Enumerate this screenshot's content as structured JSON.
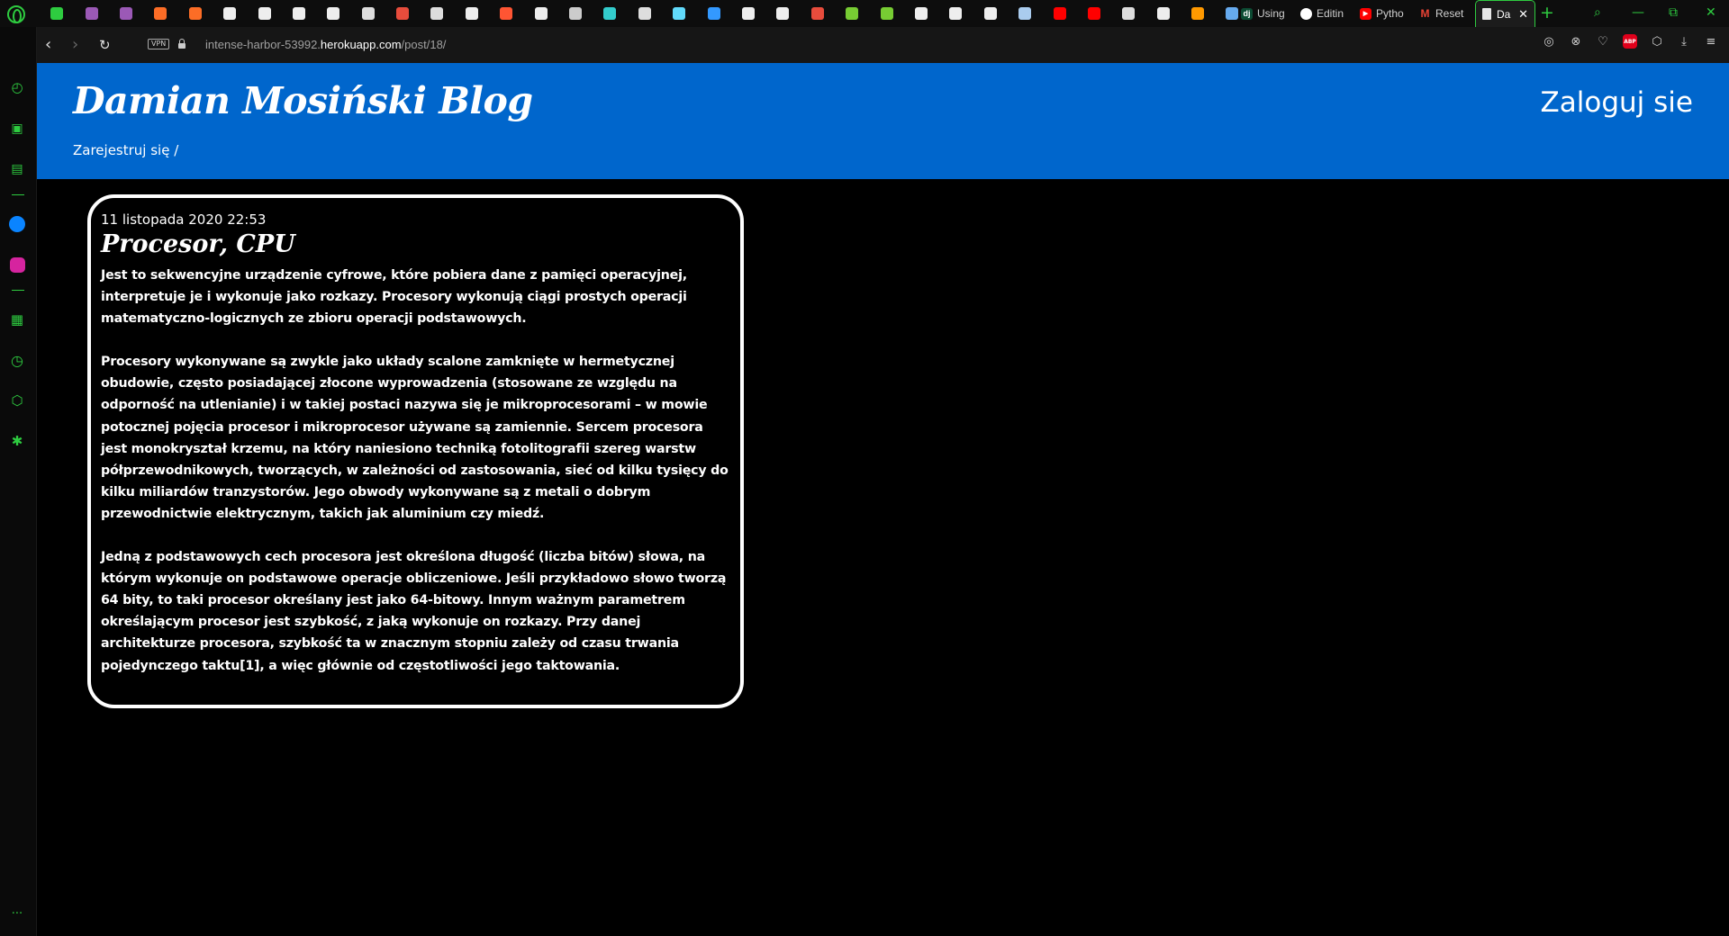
{
  "browser": {
    "pinned_tab_colors": [
      "#2ecc40",
      "#9b59b6",
      "#9b59b6",
      "#fc6d26",
      "#fc6d26",
      "#eeeeee",
      "#eeeeee",
      "#eeeeee",
      "#eeeeee",
      "#dddddd",
      "#e74c3c",
      "#dddddd",
      "#eeeeee",
      "#ff5533",
      "#eeeeee",
      "#cccccc",
      "#33cccc",
      "#dddddd",
      "#61dafb",
      "#3399ff",
      "#eeeeee",
      "#eeeeee",
      "#e74c3c",
      "#77cc33",
      "#77cc33",
      "#eeeeee",
      "#eeeeee",
      "#eeeeee",
      "#aaccee",
      "#ff0000",
      "#ff0000",
      "#dddddd",
      "#eeeeee",
      "#ff9900",
      "#66aaee"
    ],
    "named_tabs": [
      {
        "label": "Using",
        "fav_text": "dj",
        "fav_color": "#0c4b33"
      },
      {
        "label": "Editin",
        "fav_text": "",
        "fav_color": "#ffffff"
      },
      {
        "label": "Pytho",
        "fav_text": "▶",
        "fav_color": "#ff0000"
      },
      {
        "label": "Reset",
        "fav_text": "M",
        "fav_color": "#ea4335"
      }
    ],
    "active_tab": {
      "label": "Da",
      "close_glyph": "✕"
    },
    "new_tab_glyph": "+",
    "window_controls": {
      "search": "⌕",
      "minimize": "—",
      "restore": "⧉",
      "close": "✕"
    },
    "nav": {
      "back": "‹",
      "forward": "›",
      "reload": "↻"
    },
    "vpn_label": "VPN",
    "url_host": "intense-harbor-53992.",
    "url_domain": "herokuapp.com",
    "url_path": "/post/18/",
    "toolbar_icons": {
      "camera": "◎",
      "block": "⊗",
      "heart": "♡",
      "abp": "ABP",
      "box": "⬡",
      "download": "⤓",
      "menu": "≡"
    },
    "sidebar": {
      "speed_dial": "◴",
      "bag": "▣",
      "twitch": "▤",
      "messenger": "✉",
      "instagram": "◙",
      "apps": "▦",
      "history": "◷",
      "cube": "⬡",
      "settings": "✱",
      "more": "···"
    }
  },
  "site": {
    "brand": "Damian Mosiński Blog",
    "register_label": "Zarejestruj się /",
    "login_label": "Zaloguj sie"
  },
  "post": {
    "date": "11 listopada 2020 22:53",
    "title": "Procesor, CPU",
    "paragraphs": [
      "Jest to sekwencyjne urządzenie cyfrowe, które pobiera dane z pamięci operacyjnej, interpretuje je i wykonuje jako rozkazy. Procesory wykonują ciągi prostych operacji matematyczno-logicznych ze zbioru operacji podstawowych.",
      "Procesory wykonywane są zwykle jako układy scalone zamknięte w hermetycznej obudowie, często posiadającej złocone wyprowadzenia (stosowane ze względu na odporność na utlenianie) i w takiej postaci nazywa się je mikroprocesorami – w mowie potocznej pojęcia procesor i mikroprocesor używane są zamiennie. Sercem procesora jest monokryształ krzemu, na który naniesiono techniką fotolitografii szereg warstw półprzewodnikowych, tworzących, w zależności od zastosowania, sieć od kilku tysięcy do kilku miliardów tranzystorów. Jego obwody wykonywane są z metali o dobrym przewodnictwie elektrycznym, takich jak aluminium czy miedź.",
      "Jedną z podstawowych cech procesora jest określona długość (liczba bitów) słowa, na którym wykonuje on podstawowe operacje obliczeniowe. Jeśli przykładowo słowo tworzą 64 bity, to taki procesor określany jest jako 64-bitowy. Innym ważnym parametrem określającym procesor jest szybkość, z jaką wykonuje on rozkazy. Przy danej architekturze procesora, szybkość ta w znacznym stopniu zależy od czasu trwania pojedynczego taktu[1], a więc głównie od częstotliwości jego taktowania."
    ]
  },
  "colors": {
    "header_blue": "#0066cc",
    "opera_green": "#2ecc40",
    "page_bg": "#000000"
  }
}
